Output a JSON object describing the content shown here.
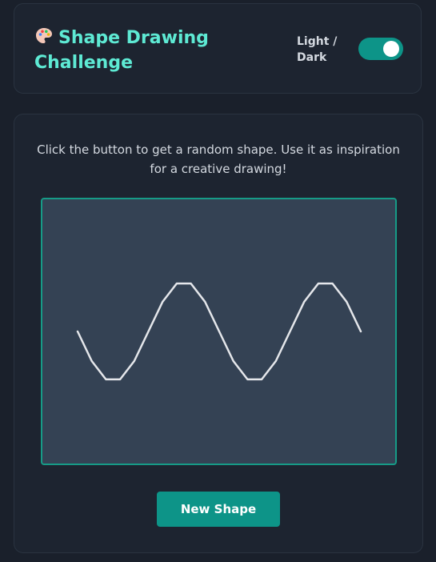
{
  "header": {
    "icon": "palette-icon",
    "title": "Shape Drawing Challenge",
    "theme_toggle_label": "Light / Dark",
    "theme_toggle_on": true
  },
  "main": {
    "instruction": "Click the button to get a random shape. Use it as inspiration for a creative drawing!",
    "shape": {
      "type": "sine-wave",
      "cycles": 2,
      "stroke_color": "#e5e7eb"
    },
    "button_label": "New Shape"
  },
  "colors": {
    "accent": "#0d9488",
    "title": "#5eead4",
    "background": "#1a202b",
    "canvas": "#344254"
  }
}
